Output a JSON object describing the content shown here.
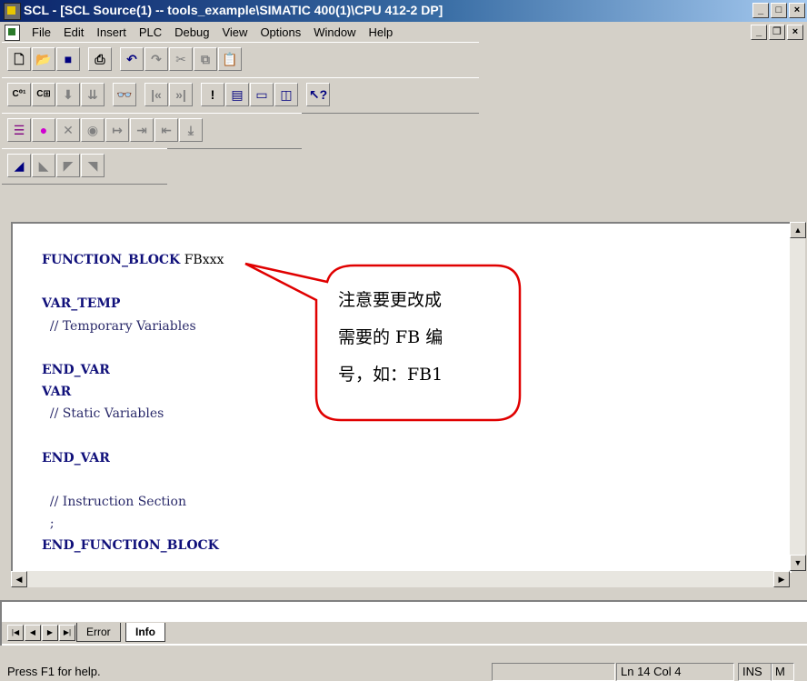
{
  "window": {
    "title": "SCL  - [SCL Source(1) -- tools_example\\SIMATIC 400(1)\\CPU 412-2 DP]",
    "minimize_glyph": "_",
    "maximize_glyph": "□",
    "close_glyph": "×",
    "restore_glyph": "❐"
  },
  "menu": [
    "File",
    "Edit",
    "Insert",
    "PLC",
    "Debug",
    "View",
    "Options",
    "Window",
    "Help"
  ],
  "toolbars": {
    "standard": [
      "new-icon",
      "open-icon",
      "save-icon",
      "print-icon",
      "undo-icon",
      "redo-icon",
      "cut-icon",
      "copy-icon",
      "paste-icon"
    ],
    "compile": [
      "compile-icon",
      "compile-all-icon",
      "download-icon",
      "download-all-icon",
      "monitor-icon",
      "prev-error-icon",
      "next-error-icon",
      "toggle-icon",
      "window-1-icon",
      "window-2-icon",
      "window-3-icon",
      "help-cursor-icon"
    ],
    "debug": [
      "list-icon",
      "breakpoint-icon",
      "remove-breakpoints-icon",
      "activate-breakpoints-icon",
      "step-into-icon",
      "step-over-icon",
      "step-out-icon",
      "run-to-cursor-icon"
    ],
    "bookmark": [
      "set-bookmark-icon",
      "next-bookmark-icon",
      "prev-bookmark-icon",
      "remove-bookmarks-icon"
    ]
  },
  "code": {
    "line1": "FUNCTION_BLOCK FBxxx",
    "line1_kw": "FUNCTION_BLOCK",
    "line1_name": "FBxxx",
    "line2": "",
    "line3": "VAR_TEMP",
    "line4": "  // Temporary Variables",
    "line5": "",
    "line6": "END_VAR",
    "line7": "VAR",
    "line8": "  // Static Variables",
    "line9": "",
    "line10": "END_VAR",
    "line11": "",
    "line12": "  // Instruction Section",
    "line13": "  ;",
    "line14": "END_FUNCTION_BLOCK"
  },
  "callout": {
    "line1": "注意要更改成",
    "line2": "需要的 FB 编",
    "line3": "号，如：FB1",
    "border_color": "#e00000"
  },
  "output": {
    "tabs": [
      "Error",
      "Info"
    ],
    "active_tab": "Info"
  },
  "status": {
    "help": "Press F1 for help.",
    "position": "Ln 14 Col 4",
    "mode": "INS",
    "extra": "M"
  }
}
